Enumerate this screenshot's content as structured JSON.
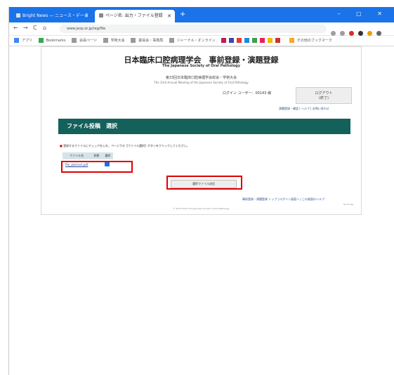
{
  "browser": {
    "tabs": [
      {
        "label": "Bright News — ニュース・データ"
      },
      {
        "label": "ページ名: 出力・ファイル登録"
      }
    ],
    "new_tab": "+",
    "window_controls": "–  ▢  ✕",
    "address": "www.jsop.or.jp/reg/file",
    "nav": {
      "back": "←",
      "forward": "→",
      "reload": "C",
      "home": "⌂"
    },
    "bookmarks": [
      "アプリ",
      "Bookmarks",
      "会員ページ",
      "学術大会",
      "委員会・事務局",
      "ジャーナル・オンライン",
      "その他のブックマーク"
    ],
    "colors": {
      "chrome": "#1a73e8",
      "accent": "#14605a",
      "highlight": "#e00000"
    }
  },
  "page": {
    "site_title": "日本臨床口腔病理学会　事前登録・演題登録",
    "site_subtitle": "The Japanese Society of Oral Pathology",
    "meeting_line_1": "第33回日本臨床口腔病理学会総会・学術大会",
    "meeting_line_2": "The 33rd Annual Meeting of the Japanese Society of Oral Pathology",
    "login_status": "ログイン ユーザー：00143 様",
    "login_button": "ログアウト\n(終了)",
    "small_links": "演題登録・確認 | ヘルプ | お問い合わせ",
    "section_title": "ファイル投稿　選択",
    "instruction": "登録するファイルにチェックを入れ、ページ下の【ファイル選択】ボタンをクリックしてください。",
    "table": {
      "headers": [
        "ファイル名",
        "状態",
        "選択"
      ],
      "rows": [
        {
          "file": "file_abstract.pdf",
          "status": "",
          "checked": true
        }
      ]
    },
    "select_button": "選択ファイル送信",
    "footer_links": "事前登録・演題登録 トップ | ログイン画面へ | この画面のヘルプ",
    "footer_small": "Go to top",
    "copyright": "© 2015-2022 The Japanese Society of Oral Pathology"
  }
}
